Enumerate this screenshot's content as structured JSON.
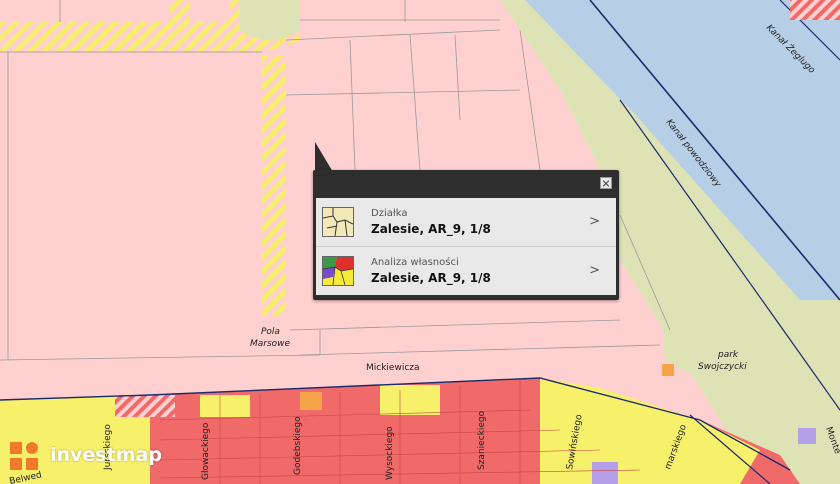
{
  "map": {
    "labels": {
      "canal": "Kanał Żeglugo",
      "flood_channel": "Kanał powodziowy",
      "pola": "Pola",
      "marsowe": "Marsowe",
      "mickiewicza": "Mickiewicza",
      "park": "park",
      "swojczycki": "Swojczycki",
      "glowackiego": "Głowackiego",
      "godebskiego": "Godebskiego",
      "wysockiego": "Wysockiego",
      "szanieckiego": "Szanieckiego",
      "sowinskiego": "Sowińskiego",
      "sienkiewicza": "Jursskiego",
      "belwederska": "Belwed",
      "szymanarskiego": "marskiego",
      "monte": "Monte"
    },
    "colors": {
      "residential_pink": "#ffd0d0",
      "urban_red": "#f06a6a",
      "yellow_zone": "#f7f06a",
      "water": "#b7cfe6",
      "green": "#dde3b5",
      "hatch_yellow": "#f5ee6a"
    }
  },
  "popup": {
    "close_icon": "close-icon",
    "rows": [
      {
        "title": "Działka",
        "value": "Zalesie, AR_9, 1/8",
        "icon": "parcel-map-icon"
      },
      {
        "title": "Analiza własności",
        "value": "Zalesie, AR_9, 1/8",
        "icon": "ownership-map-icon"
      }
    ],
    "chevron": ">"
  },
  "logo": {
    "text": "investmap",
    "icon": "investmap-logo-icon"
  }
}
